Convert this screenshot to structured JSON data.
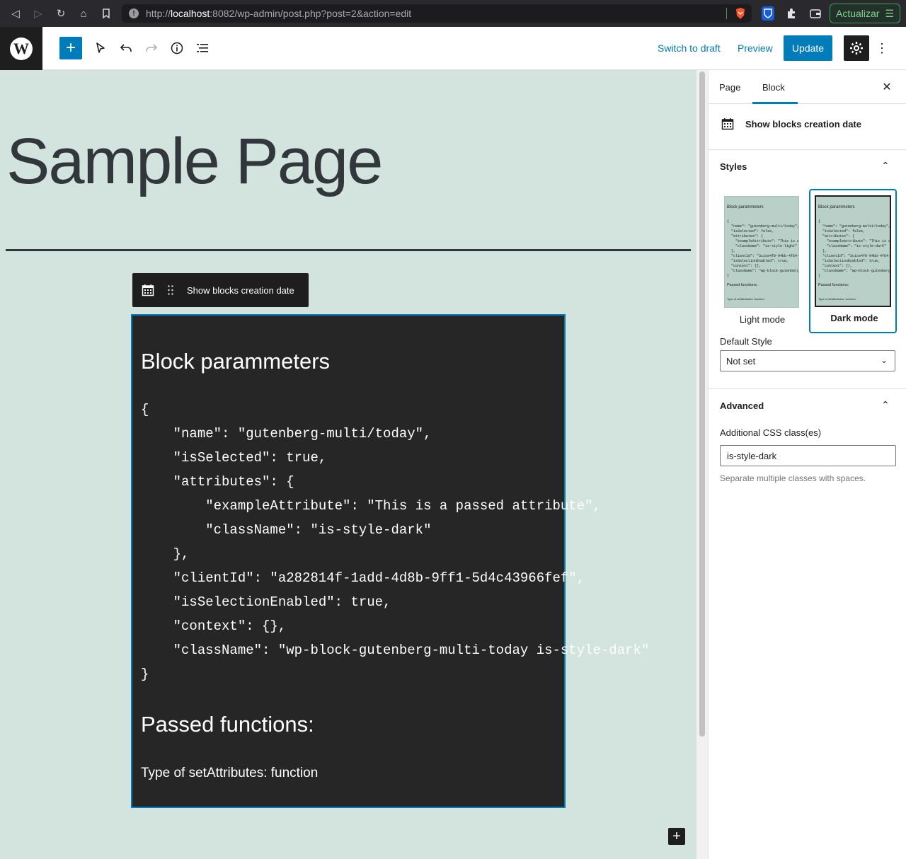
{
  "browser": {
    "url_prefix": "http://",
    "url_host": "localhost",
    "url_rest": ":8082/wp-admin/post.php?post=2&action=edit",
    "update_button_label": "Actualizar"
  },
  "header": {
    "switch_draft_label": "Switch to draft",
    "preview_label": "Preview",
    "update_label": "Update"
  },
  "canvas": {
    "page_title": "Sample Page",
    "block_toolbar_label": "Show blocks creation date",
    "block_heading": "Block parammeters",
    "code_lines": [
      "{",
      "    \"name\": \"gutenberg-multi/today\",",
      "    \"isSelected\": true,",
      "    \"attributes\": {",
      "        \"exampleAttribute\": \"This is a passed attribute\",",
      "        \"className\": \"is-style-dark\"",
      "    },",
      "    \"clientId\": \"a282814f-1add-4d8b-9ff1-5d4c43966fef\",",
      "    \"isSelectionEnabled\": true,",
      "    \"context\": {},",
      "    \"className\": \"wp-block-gutenberg-multi-today is-style-dark\"",
      "}"
    ],
    "functions_heading": "Passed functions:",
    "functions_line": "Type of setAttributes: function"
  },
  "sidebar": {
    "tab_page": "Page",
    "tab_block": "Block",
    "block_card_title": "Show blocks creation date",
    "styles_header": "Styles",
    "style_options": [
      {
        "label": "Light mode",
        "selected": false
      },
      {
        "label": "Dark mode",
        "selected": true
      }
    ],
    "preview_title": "Block parammeters",
    "preview_code_light": "{\n  \"name\": \"gutenberg-multi/today\",\n  \"isSelected\": false,\n  \"attributes\": {\n    \"exampleAttribute\": \"This is a p\n    \"className\": \"is-style-light\"\n  },\n  \"clientId\": \"3c1ce4f0-94bb-4f64-b011\n  \"isSelectionEnabled\": true,\n  \"context\": {},\n  \"className\": \"wp-block-gutenberg-mult\n}",
    "preview_code_dark": "{\n  \"name\": \"gutenberg-multi/today\",\n  \"isSelected\": false,\n  \"attributes\": {\n    \"exampleAttribute\": \"This is a p\n    \"className\": \"is-style-dark\"\n  },\n  \"clientId\": \"3c1ce4f0-94bb-4f64-b011\n  \"isSelectionEnabled\": true,\n  \"context\": {},\n  \"className\": \"wp-block-gutenberg-mult\n}",
    "preview_passed": "Passed functions:",
    "preview_type": "Type of setAttributes: function",
    "default_style_label": "Default Style",
    "default_style_value": "Not set",
    "advanced_header": "Advanced",
    "css_class_label": "Additional CSS class(es)",
    "css_class_value": "is-style-dark",
    "css_class_help": "Separate multiple classes with spaces."
  },
  "colors": {
    "accent": "#007cba",
    "canvas_background": "#d2e4dd",
    "block_background": "#262626"
  }
}
